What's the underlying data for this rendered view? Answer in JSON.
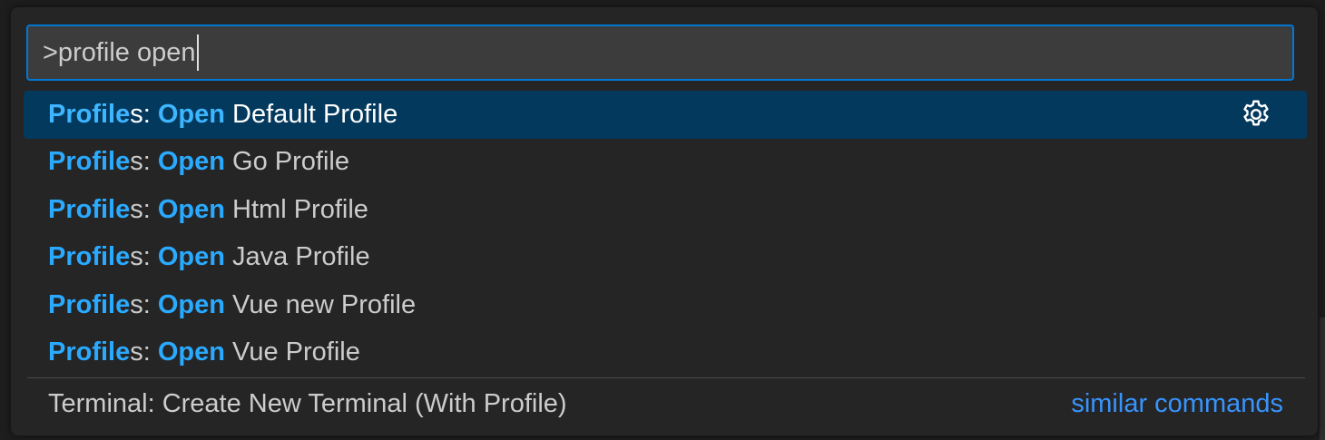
{
  "command_palette": {
    "input_value": ">profile open",
    "results": [
      {
        "highlight_prefix": "Profile",
        "rest_prefix": "s",
        "separator": ": ",
        "highlight_action": "Open",
        "label_suffix": " Default Profile",
        "selected": true
      },
      {
        "highlight_prefix": "Profile",
        "rest_prefix": "s",
        "separator": ": ",
        "highlight_action": "Open",
        "label_suffix": " Go Profile",
        "selected": false
      },
      {
        "highlight_prefix": "Profile",
        "rest_prefix": "s",
        "separator": ": ",
        "highlight_action": "Open",
        "label_suffix": " Html Profile",
        "selected": false
      },
      {
        "highlight_prefix": "Profile",
        "rest_prefix": "s",
        "separator": ": ",
        "highlight_action": "Open",
        "label_suffix": " Java Profile",
        "selected": false
      },
      {
        "highlight_prefix": "Profile",
        "rest_prefix": "s",
        "separator": ": ",
        "highlight_action": "Open",
        "label_suffix": " Vue new Profile",
        "selected": false
      },
      {
        "highlight_prefix": "Profile",
        "rest_prefix": "s",
        "separator": ": ",
        "highlight_action": "Open",
        "label_suffix": " Vue Profile",
        "selected": false
      }
    ],
    "selected_row_icon": "gear-icon",
    "footer": {
      "label": "Terminal: Create New Terminal (With Profile)",
      "link": "similar commands"
    },
    "colors": {
      "accent_border": "#0078d4",
      "highlight_text": "#2aaaff",
      "selected_background": "#04395e",
      "link": "#3794ff"
    }
  }
}
